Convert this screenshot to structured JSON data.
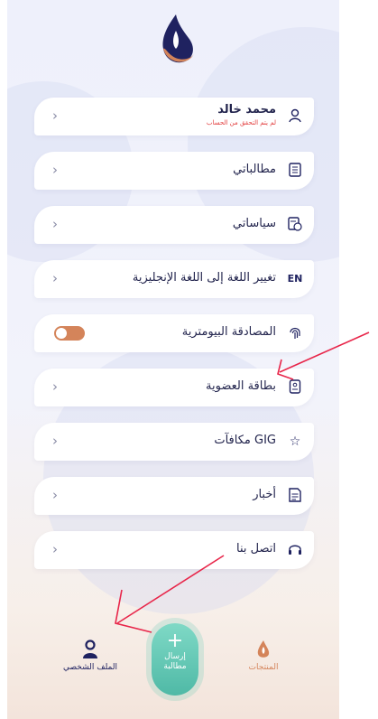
{
  "profile": {
    "name": "محمد خالد",
    "status": "لم يتم التحقق من الحساب",
    "icon": "user-icon"
  },
  "menu": [
    {
      "label": "مطالباتي",
      "icon": "document-icon"
    },
    {
      "label": "سياساتي",
      "icon": "policy-icon"
    },
    {
      "label": "تغيير اللغة إلى اللغة الإنجليزية",
      "icon_text": "EN"
    },
    {
      "label": "المصادقة البيومترية",
      "icon": "fingerprint-icon",
      "toggle_on": true
    },
    {
      "label": "بطاقة العضوية",
      "icon": "id-card-icon"
    },
    {
      "label": "GIG مكافآت",
      "icon": "star-icon"
    },
    {
      "label": "أخبار",
      "icon": "news-icon"
    },
    {
      "label": "اتصل بنا",
      "icon": "headset-icon"
    }
  ],
  "tabs": {
    "profile": "الملف الشخصي",
    "products": "المنتجات",
    "submit_line1": "إرسال",
    "submit_line2": "مطالبة"
  },
  "colors": {
    "navy": "#1f2260",
    "accent": "#d4845a",
    "teal": "#4fb9a6",
    "alert": "#e23b3b"
  }
}
